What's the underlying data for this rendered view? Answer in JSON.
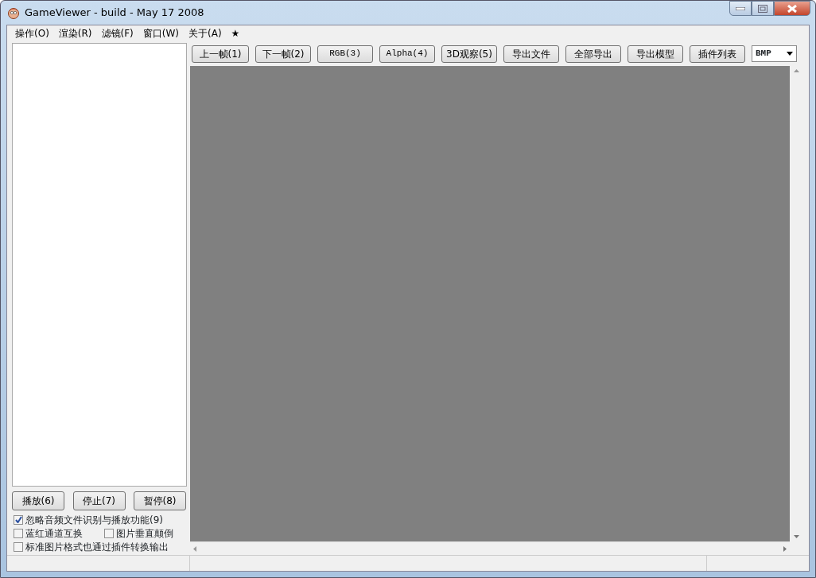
{
  "window": {
    "title": "GameViewer - build - May 17 2008"
  },
  "menu": [
    "操作(O)",
    "渲染(R)",
    "滤镜(F)",
    "窗口(W)",
    "关于(A)",
    "★"
  ],
  "toolbar": [
    {
      "label": "上一帧(1)",
      "kind": "cjk"
    },
    {
      "label": "下一帧(2)",
      "kind": "cjk"
    },
    {
      "label": "RGB(3)",
      "kind": "mono"
    },
    {
      "label": "Alpha(4)",
      "kind": "mono"
    },
    {
      "label": "3D观察(5)",
      "kind": "cjk"
    },
    {
      "label": "导出文件",
      "kind": "cjk"
    },
    {
      "label": "全部导出",
      "kind": "cjk"
    },
    {
      "label": "导出模型",
      "kind": "cjk"
    },
    {
      "label": "插件列表",
      "kind": "cjk"
    }
  ],
  "format_select": {
    "value": "BMP"
  },
  "playback": [
    "播放(6)",
    "停止(7)",
    "暂停(8)"
  ],
  "options": [
    {
      "label": "忽略音频文件识别与播放功能(9)",
      "checked": true
    },
    {
      "label": "蓝红通道互换",
      "checked": false
    },
    {
      "label": "图片垂直颠倒",
      "checked": false
    },
    {
      "label": "标准图片格式也通过插件转换输出",
      "checked": false
    }
  ]
}
